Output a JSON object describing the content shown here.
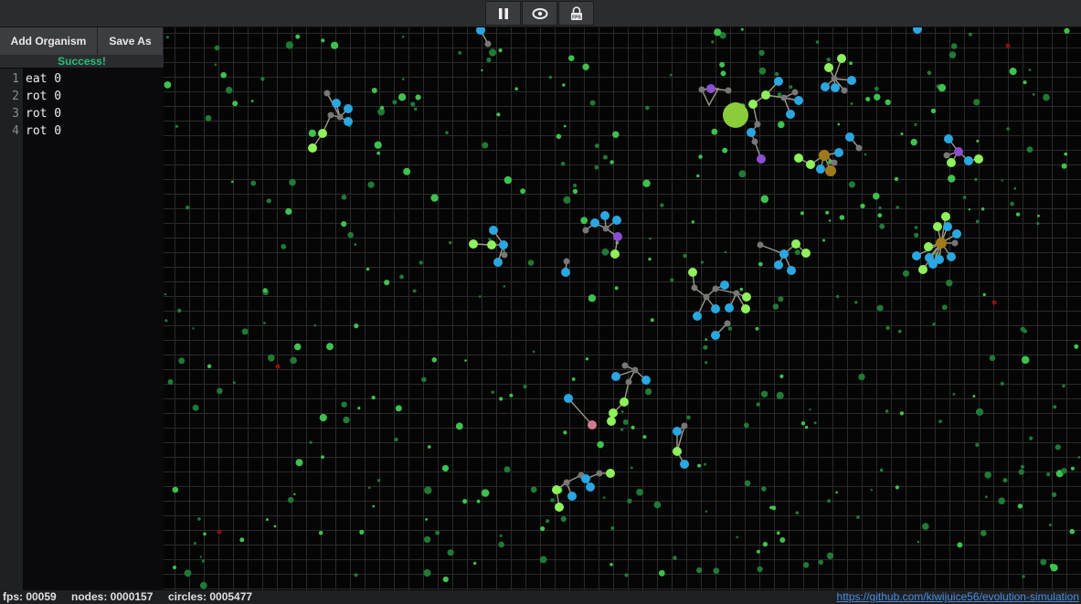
{
  "toolbar": {
    "buttons": [
      {
        "name": "pause-button",
        "icon": "pause-icon"
      },
      {
        "name": "view-button",
        "icon": "eye-icon"
      },
      {
        "name": "fps-lock-button",
        "icon": "lock-fps-icon",
        "label": "FPS"
      }
    ]
  },
  "sidebar": {
    "add_organism_label": "Add Organism",
    "save_as_label": "Save As",
    "status": "Success!",
    "code_lines": [
      {
        "num": "1",
        "text": "eat 0"
      },
      {
        "num": "2",
        "text": "rot 0"
      },
      {
        "num": "3",
        "text": "rot 0"
      },
      {
        "num": "4",
        "text": "rot 0"
      }
    ]
  },
  "footer": {
    "fps": "fps: 00059",
    "nodes": "nodes: 0000157",
    "circles": "circles: 0005477",
    "link": "https://github.com/kiwijuice56/evolution-simulation"
  },
  "colors": {
    "food_dark": "#1f7a35",
    "food_light": "#3ec24e",
    "node_blue": "#2aa7e0",
    "node_lime": "#8ef05a",
    "node_gray": "#777777",
    "node_purple": "#8a4fd0",
    "node_gold": "#a07a1a",
    "node_pink": "#d07a90",
    "link_color": "#a09a8a"
  },
  "organisms": [
    {
      "nodes": [
        [
          1004,
          32,
          "blue"
        ]
      ],
      "links": []
    },
    {
      "nodes": [
        [
          526,
          33,
          "blue"
        ],
        [
          534,
          48,
          "gray"
        ]
      ],
      "links": [
        [
          0,
          1
        ]
      ]
    },
    {
      "nodes": [
        [
          368,
          113,
          "blue"
        ],
        [
          381,
          119,
          "blue"
        ],
        [
          381,
          133,
          "blue"
        ],
        [
          372,
          128,
          "gray"
        ],
        [
          362,
          126,
          "gray"
        ],
        [
          353,
          146,
          "lime"
        ],
        [
          342,
          162,
          "lime"
        ],
        [
          358,
          102,
          "gray"
        ]
      ],
      "links": [
        [
          3,
          0
        ],
        [
          3,
          1
        ],
        [
          3,
          2
        ],
        [
          3,
          4
        ],
        [
          4,
          5
        ],
        [
          5,
          6
        ],
        [
          3,
          7
        ]
      ]
    },
    {
      "nodes": [
        [
          921,
          64,
          "lime"
        ],
        [
          907,
          74,
          "lime"
        ],
        [
          913,
          86,
          "gray"
        ],
        [
          932,
          88,
          "blue"
        ],
        [
          903,
          95,
          "blue"
        ],
        [
          914,
          96,
          "blue"
        ],
        [
          924,
          99,
          "gray"
        ]
      ],
      "links": [
        [
          0,
          2
        ],
        [
          1,
          2
        ],
        [
          2,
          3
        ],
        [
          2,
          4
        ],
        [
          2,
          5
        ],
        [
          2,
          6
        ]
      ]
    },
    {
      "nodes": [
        [
          768,
          98,
          "gray"
        ],
        [
          778,
          97,
          "purple"
        ],
        [
          797,
          99,
          "gray"
        ],
        [
          852,
          89,
          "blue"
        ],
        [
          838,
          104,
          "lime"
        ],
        [
          824,
          114,
          "lime"
        ],
        [
          858,
          107,
          "gray"
        ],
        [
          870,
          101,
          "gray"
        ],
        [
          874,
          110,
          "blue"
        ],
        [
          865,
          125,
          "blue"
        ],
        [
          829,
          136,
          "gray"
        ],
        [
          822,
          145,
          "blue"
        ],
        [
          826,
          155,
          "gray"
        ],
        [
          833,
          174,
          "purple"
        ]
      ],
      "links": [
        [
          0,
          1
        ],
        [
          1,
          2
        ],
        [
          4,
          5
        ],
        [
          4,
          3
        ],
        [
          4,
          6
        ],
        [
          6,
          7
        ],
        [
          6,
          8
        ],
        [
          6,
          9
        ],
        [
          10,
          11
        ],
        [
          11,
          12
        ],
        [
          12,
          13
        ],
        [
          5,
          10
        ]
      ],
      "tri": [
        [
          768,
          98
        ],
        [
          786,
          97
        ],
        [
          776,
          115
        ]
      ]
    },
    {
      "nodes": [
        [
          1038,
          152,
          "blue"
        ],
        [
          1049,
          166,
          "purple"
        ],
        [
          1036,
          170,
          "gray"
        ],
        [
          1041,
          178,
          "lime"
        ],
        [
          1060,
          176,
          "blue"
        ],
        [
          1071,
          174,
          "lime"
        ]
      ],
      "links": [
        [
          0,
          1
        ],
        [
          1,
          2
        ],
        [
          1,
          3
        ],
        [
          1,
          4
        ],
        [
          4,
          5
        ]
      ]
    },
    {
      "nodes": [
        [
          930,
          150,
          "blue"
        ],
        [
          940,
          162,
          "gray"
        ],
        [
          918,
          167,
          "blue"
        ],
        [
          902,
          170,
          "gold"
        ],
        [
          887,
          180,
          "lime"
        ],
        [
          874,
          173,
          "lime"
        ],
        [
          898,
          185,
          "blue"
        ],
        [
          909,
          187,
          "gold"
        ],
        [
          913,
          178,
          "gray"
        ]
      ],
      "links": [
        [
          0,
          1
        ],
        [
          3,
          2
        ],
        [
          3,
          4
        ],
        [
          4,
          5
        ],
        [
          3,
          6
        ],
        [
          3,
          7
        ],
        [
          3,
          8
        ]
      ]
    },
    {
      "nodes": [
        [
          540,
          252,
          "blue"
        ],
        [
          551,
          268,
          "blue"
        ],
        [
          538,
          268,
          "lime"
        ],
        [
          518,
          267,
          "lime"
        ],
        [
          545,
          287,
          "blue"
        ],
        [
          552,
          279,
          "gray"
        ]
      ],
      "links": [
        [
          0,
          1
        ],
        [
          1,
          2
        ],
        [
          2,
          3
        ],
        [
          1,
          4
        ],
        [
          1,
          5
        ]
      ]
    },
    {
      "nodes": [
        [
          662,
          236,
          "blue"
        ],
        [
          675,
          241,
          "blue"
        ],
        [
          651,
          244,
          "blue"
        ],
        [
          641,
          252,
          "gray"
        ],
        [
          663,
          250,
          "gray"
        ],
        [
          676,
          259,
          "purple"
        ],
        [
          673,
          278,
          "lime"
        ]
      ],
      "links": [
        [
          4,
          0
        ],
        [
          4,
          1
        ],
        [
          4,
          2
        ],
        [
          2,
          3
        ],
        [
          4,
          5
        ],
        [
          5,
          6
        ]
      ]
    },
    {
      "nodes": [
        [
          620,
          286,
          "gray"
        ],
        [
          619,
          298,
          "blue"
        ]
      ],
      "links": [
        [
          0,
          1
        ]
      ]
    },
    {
      "nodes": [
        [
          1035,
          237,
          "lime"
        ],
        [
          1026,
          248,
          "lime"
        ],
        [
          1037,
          248,
          "blue"
        ],
        [
          1047,
          256,
          "blue"
        ],
        [
          1030,
          266,
          "gold"
        ],
        [
          1045,
          266,
          "gray"
        ],
        [
          1016,
          270,
          "lime"
        ],
        [
          1003,
          280,
          "blue"
        ],
        [
          1017,
          282,
          "blue"
        ],
        [
          1028,
          284,
          "blue"
        ],
        [
          1041,
          281,
          "blue"
        ],
        [
          1010,
          295,
          "lime"
        ],
        [
          1021,
          289,
          "blue"
        ]
      ],
      "links": [
        [
          4,
          0
        ],
        [
          4,
          1
        ],
        [
          4,
          2
        ],
        [
          4,
          3
        ],
        [
          4,
          5
        ],
        [
          4,
          6
        ],
        [
          4,
          7
        ],
        [
          4,
          8
        ],
        [
          4,
          9
        ],
        [
          4,
          10
        ],
        [
          4,
          11
        ],
        [
          4,
          12
        ]
      ]
    },
    {
      "nodes": [
        [
          832,
          268,
          "gray"
        ],
        [
          858,
          278,
          "blue"
        ],
        [
          871,
          267,
          "lime"
        ],
        [
          882,
          277,
          "lime"
        ],
        [
          852,
          290,
          "blue"
        ],
        [
          866,
          296,
          "blue"
        ]
      ],
      "links": [
        [
          0,
          1
        ],
        [
          1,
          2
        ],
        [
          2,
          3
        ],
        [
          1,
          4
        ],
        [
          1,
          5
        ]
      ]
    },
    {
      "nodes": [
        [
          758,
          298,
          "lime"
        ],
        [
          760,
          315,
          "gray"
        ],
        [
          773,
          325,
          "gray"
        ],
        [
          783,
          316,
          "gray"
        ],
        [
          793,
          312,
          "blue"
        ],
        [
          806,
          321,
          "gray"
        ],
        [
          817,
          325,
          "lime"
        ],
        [
          816,
          338,
          "lime"
        ],
        [
          798,
          337,
          "blue"
        ],
        [
          783,
          338,
          "blue"
        ],
        [
          763,
          346,
          "blue"
        ],
        [
          796,
          354,
          "gray"
        ],
        [
          783,
          367,
          "blue"
        ]
      ],
      "links": [
        [
          0,
          1
        ],
        [
          1,
          2
        ],
        [
          2,
          3
        ],
        [
          3,
          4
        ],
        [
          3,
          5
        ],
        [
          5,
          6
        ],
        [
          5,
          7
        ],
        [
          5,
          8
        ],
        [
          2,
          9
        ],
        [
          2,
          10
        ],
        [
          11,
          12
        ]
      ]
    },
    {
      "nodes": [
        [
          684,
          400,
          "gray"
        ],
        [
          695,
          405,
          "gray"
        ],
        [
          707,
          416,
          "blue"
        ],
        [
          674,
          412,
          "blue"
        ],
        [
          688,
          418,
          "gray"
        ],
        [
          683,
          440,
          "lime"
        ],
        [
          671,
          452,
          "lime"
        ],
        [
          669,
          461,
          "lime"
        ]
      ],
      "links": [
        [
          0,
          1
        ],
        [
          1,
          2
        ],
        [
          1,
          3
        ],
        [
          1,
          4
        ],
        [
          4,
          5
        ],
        [
          5,
          6
        ],
        [
          6,
          7
        ]
      ]
    },
    {
      "nodes": [
        [
          622,
          436,
          "blue"
        ],
        [
          648,
          465,
          "pink"
        ]
      ],
      "links": [
        [
          0,
          1
        ]
      ]
    },
    {
      "nodes": [
        [
          749,
          466,
          "gray"
        ],
        [
          741,
          472,
          "blue"
        ],
        [
          741,
          494,
          "lime"
        ],
        [
          749,
          508,
          "blue"
        ]
      ],
      "links": [
        [
          0,
          1
        ],
        [
          1,
          2
        ],
        [
          2,
          3
        ],
        [
          0,
          2
        ]
      ]
    },
    {
      "nodes": [
        [
          636,
          520,
          "gray"
        ],
        [
          641,
          524,
          "blue"
        ],
        [
          656,
          518,
          "gray"
        ],
        [
          668,
          518,
          "lime"
        ],
        [
          620,
          528,
          "gray"
        ],
        [
          609,
          536,
          "lime"
        ],
        [
          626,
          543,
          "blue"
        ],
        [
          646,
          533,
          "blue"
        ],
        [
          612,
          555,
          "lime"
        ]
      ],
      "links": [
        [
          0,
          1
        ],
        [
          1,
          2
        ],
        [
          2,
          3
        ],
        [
          0,
          4
        ],
        [
          4,
          5
        ],
        [
          4,
          6
        ],
        [
          1,
          7
        ],
        [
          5,
          8
        ]
      ]
    }
  ],
  "big_food": [
    805,
    126
  ]
}
